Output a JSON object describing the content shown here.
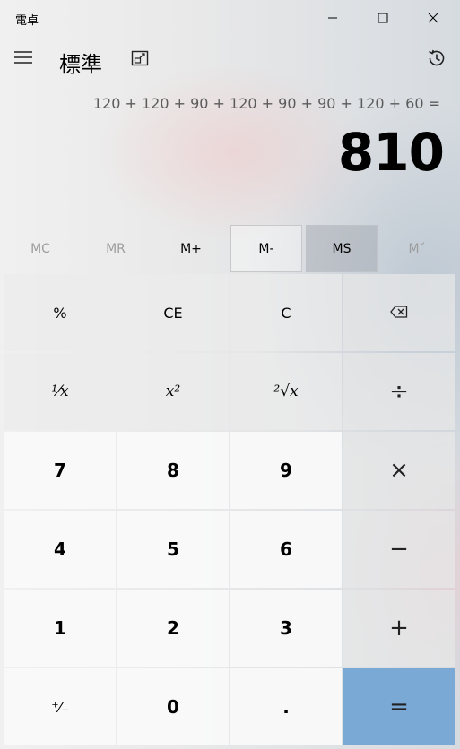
{
  "window": {
    "title": "電卓",
    "controls": {
      "minimize_icon": "minimize-icon",
      "maximize_icon": "maximize-icon",
      "close_icon": "close-icon"
    }
  },
  "header": {
    "mode_title": "標準",
    "menu_icon": "hamburger-menu-icon",
    "keep_on_top_icon": "keep-on-top-icon",
    "history_icon": "history-icon"
  },
  "display": {
    "expression": "120 + 120 + 90 + 120 + 90 + 90 + 120 + 60 =",
    "result": "810"
  },
  "memory": {
    "mc": "MC",
    "mr": "MR",
    "m_plus": "M+",
    "m_minus": "M-",
    "ms": "MS",
    "m_list": "M˅"
  },
  "keys": {
    "percent": "%",
    "ce": "CE",
    "c": "C",
    "backspace_icon": "backspace-icon",
    "reciprocal": "¹⁄x",
    "square": "x²",
    "sqrt": "²√x",
    "divide": "÷",
    "seven": "7",
    "eight": "8",
    "nine": "9",
    "multiply": "×",
    "four": "4",
    "five": "5",
    "six": "6",
    "minus": "−",
    "one": "1",
    "two": "2",
    "three": "3",
    "plus": "+",
    "negate": "⁺⁄₋",
    "zero": "0",
    "decimal": ".",
    "equals": "="
  },
  "colors": {
    "equals_accent": "#7aa9d6"
  }
}
